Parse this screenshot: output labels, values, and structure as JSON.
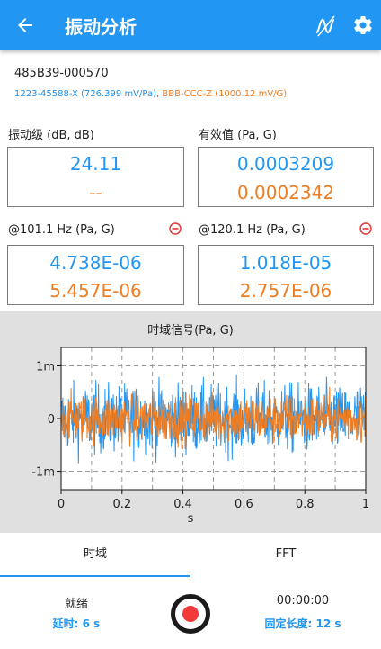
{
  "appbar": {
    "title": "振动分析",
    "icons": [
      "back-arrow-icon",
      "waveform-icon",
      "gear-icon"
    ]
  },
  "device": {
    "id": "485B39-000570"
  },
  "sensors": {
    "a": "1223-45588-X (726.399 mV/Pa)",
    "separator": ",",
    "b": "BBB-CCC-Z (1000.12 mV/G)"
  },
  "colors": {
    "accent": "#2196f3",
    "series_a": "#2196f3",
    "series_b": "#ef7d22",
    "remove": "#e53935",
    "record": "#f23a3a"
  },
  "metrics": {
    "level": {
      "label": "振动级 (dB, dB)",
      "value_a": "24.11",
      "value_b": "--"
    },
    "rms": {
      "label": "有效值 (Pa, G)",
      "value_a": "0.0003209",
      "value_b": "0.0002342"
    },
    "peak1": {
      "label": "@101.1 Hz (Pa, G)",
      "value_a": "4.738E-06",
      "value_b": "5.457E-06"
    },
    "peak2": {
      "label": "@120.1 Hz (Pa, G)",
      "value_a": "1.018E-05",
      "value_b": "2.757E-06"
    }
  },
  "chart_data": {
    "type": "line",
    "title": "时域信号(Pa, G)",
    "xlabel": "s",
    "ylabel": "",
    "xlim": [
      0,
      1
    ],
    "ylim": [
      -1.35,
      1.35
    ],
    "x_ticks": [
      "0",
      "0.2",
      "0.4",
      "0.6",
      "0.8",
      "1"
    ],
    "y_ticks": [
      {
        "value": 1,
        "label": "1m"
      },
      {
        "value": 0,
        "label": "0"
      },
      {
        "value": -1,
        "label": "-1m"
      }
    ],
    "grid": true,
    "series": [
      {
        "color": "#2196f3",
        "approx_amplitude": 1.1,
        "approx_rms": 0.32
      },
      {
        "color": "#ef7d22",
        "approx_amplitude": 0.75,
        "approx_rms": 0.23
      }
    ]
  },
  "tabs": [
    {
      "label": "时域",
      "active": true
    },
    {
      "label": "FFT",
      "active": false
    }
  ],
  "footer": {
    "status": "就绪",
    "delay": "延时: 6 s",
    "elapsed": "00:00:00",
    "fixed_length": "固定长度: 12 s"
  }
}
